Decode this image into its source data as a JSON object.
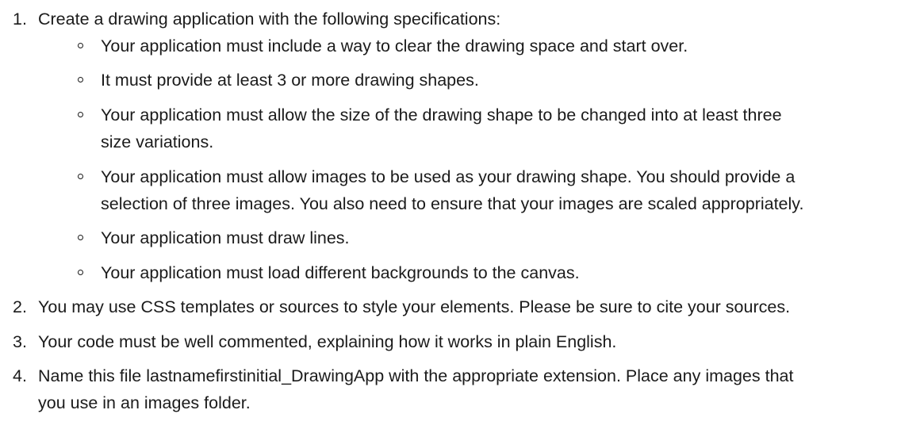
{
  "list": {
    "item1": {
      "number": "1.",
      "text": "Create a drawing application with the following specifications:",
      "subitems": [
        {
          "line1": "Your application must include a way to clear the drawing space and start over."
        },
        {
          "line1": "It must provide at least 3 or more drawing shapes."
        },
        {
          "line1": "Your application must allow the size of the drawing shape to be changed into at least three",
          "line2": "size variations."
        },
        {
          "line1": "Your application must allow images to be used as your drawing shape. You should provide a",
          "line2": "selection of three images. You also need to ensure that your images are scaled appropriately."
        },
        {
          "line1": "Your application must draw lines."
        },
        {
          "line1": "Your application must load different backgrounds to the canvas."
        }
      ]
    },
    "item2": {
      "number": "2.",
      "text": "You may use CSS templates or sources to style your elements. Please be sure to cite your sources."
    },
    "item3": {
      "number": "3.",
      "text": "Your code must be well commented, explaining how it works in plain English."
    },
    "item4": {
      "number": "4.",
      "line1": "Name this file lastnamefirstinitial_DrawingApp with the appropriate extension. Place any images that",
      "line2": "you use in an images folder."
    }
  }
}
